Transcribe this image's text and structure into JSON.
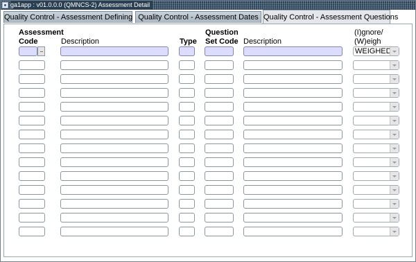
{
  "window": {
    "title": "ga1app : v01.0.0.0 (QMNCS-2) Assessment Detail"
  },
  "tabs": [
    {
      "label": "Quality Control - Assessment Defining",
      "active": false
    },
    {
      "label": "Quality Control - Assessment Dates",
      "active": false
    },
    {
      "label": "Quality Control - Assessment Questions",
      "active": true
    }
  ],
  "headers": {
    "assessment_code_line1": "Assessment",
    "assessment_code_line2": "Code",
    "description1": "Description",
    "type": "Type",
    "question_set_code_line1": "Question",
    "question_set_code_line2": "Set Code",
    "description2": "Description",
    "ignore_weigh_line1": "(I)gnore/",
    "ignore_weigh_line2": "(W)eigh"
  },
  "lookup_button": {
    "label": "..."
  },
  "rows": [
    {
      "ignore_weigh": "WEIGHED"
    },
    {
      "ignore_weigh": ""
    },
    {
      "ignore_weigh": ""
    },
    {
      "ignore_weigh": ""
    },
    {
      "ignore_weigh": ""
    },
    {
      "ignore_weigh": ""
    },
    {
      "ignore_weigh": ""
    },
    {
      "ignore_weigh": ""
    },
    {
      "ignore_weigh": ""
    },
    {
      "ignore_weigh": ""
    },
    {
      "ignore_weigh": ""
    },
    {
      "ignore_weigh": ""
    },
    {
      "ignore_weigh": ""
    },
    {
      "ignore_weigh": ""
    }
  ],
  "colors": {
    "selected_row": "#dcdcff",
    "titlebar": "#2b3f52",
    "active_tab": "#e3e6ea"
  }
}
